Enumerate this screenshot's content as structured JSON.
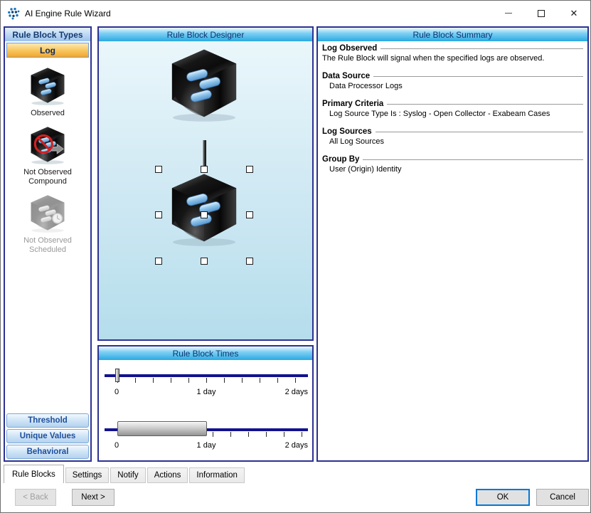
{
  "window": {
    "title": "AI Engine Rule Wizard",
    "controls": {
      "minimize": "—",
      "maximize": "",
      "close": "✕"
    }
  },
  "left_panel": {
    "header": "Rule Block Types",
    "log_button": "Log",
    "items": [
      {
        "label": "Observed",
        "disabled": false
      },
      {
        "label": "Not Observed Compound",
        "disabled": false
      },
      {
        "label": "Not Observed Scheduled",
        "disabled": true
      }
    ],
    "bottom_buttons": [
      "Threshold",
      "Unique Values",
      "Behavioral"
    ]
  },
  "designer": {
    "header": "Rule Block Designer"
  },
  "times": {
    "header": "Rule Block Times",
    "slider1": {
      "labels": [
        "0",
        "1 day",
        "2 days"
      ],
      "value": "0"
    },
    "slider2": {
      "labels": [
        "0",
        "1 day",
        "2 days"
      ],
      "range": "0 to 1 day"
    }
  },
  "summary": {
    "header": "Rule Block Summary",
    "sections": [
      {
        "title": "Log Observed",
        "text": "The Rule Block will signal when the specified logs are observed."
      },
      {
        "title": "Data Source",
        "text": "Data Processor Logs"
      },
      {
        "title": "Primary Criteria",
        "text": "Log Source Type Is : Syslog - Open Collector - Exabeam Cases"
      },
      {
        "title": "Log Sources",
        "text": "All Log Sources"
      },
      {
        "title": "Group By",
        "text": "User (Origin) Identity"
      }
    ]
  },
  "tabs": [
    {
      "label": "Rule Blocks",
      "active": true
    },
    {
      "label": "Settings",
      "active": false
    },
    {
      "label": "Notify",
      "active": false
    },
    {
      "label": "Actions",
      "active": false
    },
    {
      "label": "Information",
      "active": false
    }
  ],
  "footer": {
    "back_label": "< Back",
    "next_label": "Next >",
    "ok_label": "OK",
    "cancel_label": "Cancel"
  },
  "colors": {
    "header_cyan": "#29abe2",
    "panel_border_navy": "#2e3192",
    "log_button_orange": "#f2a52e",
    "left_header_blue": "#9cc2eb",
    "slider_track_navy": "#12128e",
    "ok_focus_blue": "#0078d7",
    "pill_blue": "#8ec4ea",
    "prohibition_red": "#d41f1f"
  }
}
